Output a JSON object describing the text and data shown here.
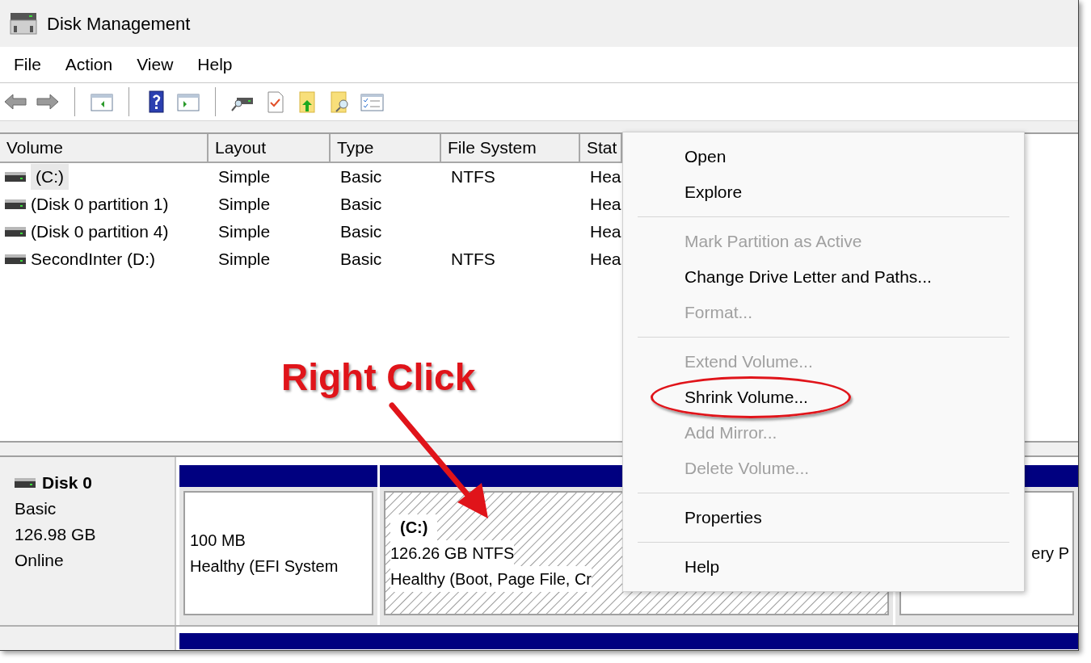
{
  "window": {
    "title": "Disk Management"
  },
  "menu_bar": [
    "File",
    "Action",
    "View",
    "Help"
  ],
  "volume_table": {
    "columns": [
      "Volume",
      "Layout",
      "Type",
      "File System",
      "Stat"
    ],
    "rows": [
      {
        "selected": true,
        "cells": [
          "(C:)",
          "Simple",
          "Basic",
          "NTFS",
          "Hea"
        ]
      },
      {
        "selected": false,
        "cells": [
          "(Disk 0 partition 1)",
          "Simple",
          "Basic",
          "",
          "Hea"
        ]
      },
      {
        "selected": false,
        "cells": [
          "(Disk 0 partition 4)",
          "Simple",
          "Basic",
          "",
          "Hea"
        ]
      },
      {
        "selected": false,
        "cells": [
          "SecondInter (D:)",
          "Simple",
          "Basic",
          "NTFS",
          "Hea"
        ]
      }
    ]
  },
  "disks": [
    {
      "name": "Disk 0",
      "type": "Basic",
      "size": "126.98 GB",
      "status": "Online",
      "partitions": [
        {
          "size": "100 MB",
          "status": "Healthy (EFI System",
          "selected": false
        },
        {
          "label": "(C:)",
          "size": "126.26 GB NTFS",
          "status": "Healthy (Boot, Page File, Cr",
          "selected": true
        },
        {
          "status": "ery P",
          "selected": false
        }
      ]
    }
  ],
  "context_menu": {
    "items": [
      {
        "kind": "item",
        "label": "Open",
        "disabled": false,
        "circled": false
      },
      {
        "kind": "item",
        "label": "Explore",
        "disabled": false,
        "circled": false
      },
      {
        "kind": "separator"
      },
      {
        "kind": "item",
        "label": "Mark Partition as Active",
        "disabled": true,
        "circled": false
      },
      {
        "kind": "item",
        "label": "Change Drive Letter and Paths...",
        "disabled": false,
        "circled": false
      },
      {
        "kind": "item",
        "label": "Format...",
        "disabled": true,
        "circled": false
      },
      {
        "kind": "separator"
      },
      {
        "kind": "item",
        "label": "Extend Volume...",
        "disabled": true,
        "circled": false
      },
      {
        "kind": "item",
        "label": "Shrink Volume...",
        "disabled": false,
        "circled": true
      },
      {
        "kind": "item",
        "label": "Add Mirror...",
        "disabled": true,
        "circled": false
      },
      {
        "kind": "item",
        "label": "Delete Volume...",
        "disabled": true,
        "circled": false
      },
      {
        "kind": "separator"
      },
      {
        "kind": "item",
        "label": "Properties",
        "disabled": false,
        "circled": false
      },
      {
        "kind": "separator"
      },
      {
        "kind": "item",
        "label": "Help",
        "disabled": false,
        "circled": false
      }
    ]
  },
  "annotation": {
    "callout": "Right Click"
  }
}
